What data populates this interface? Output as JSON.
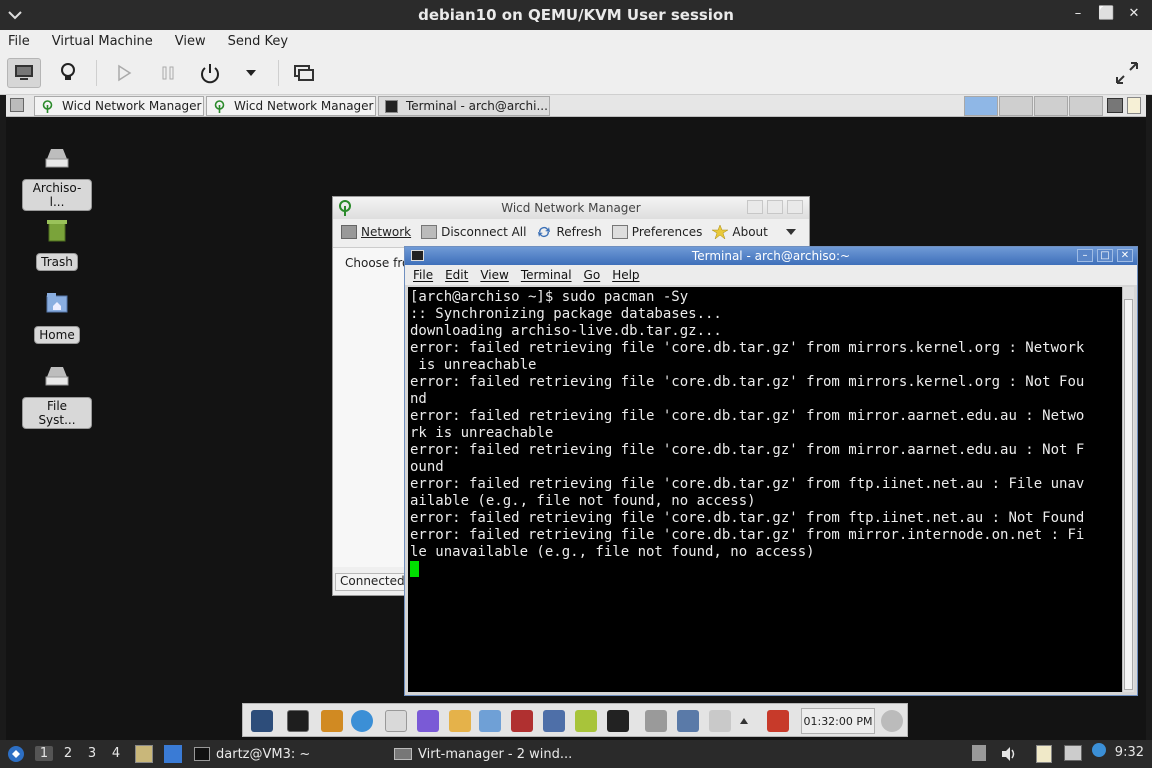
{
  "host": {
    "title": "debian10 on QEMU/KVM User session",
    "menu": [
      "File",
      "Virtual Machine",
      "View",
      "Send Key"
    ],
    "controls": {
      "minimize": "–",
      "restore": "⬜",
      "close": "✕"
    }
  },
  "guest_taskbar": {
    "tasks": [
      "Wicd Network Manager",
      "Wicd Network Manager",
      "Terminal - arch@archi..."
    ]
  },
  "desktop_icons": [
    "Archiso-l...",
    "Trash",
    "Home",
    "File Syst..."
  ],
  "wicd": {
    "title": "Wicd Network Manager",
    "toolbar": [
      "Network",
      "Disconnect All",
      "Refresh",
      "Preferences",
      "About"
    ],
    "choose_text": "Choose fro",
    "status": "Connected t"
  },
  "terminal": {
    "title": "Terminal - arch@archiso:~",
    "menu": [
      "File",
      "Edit",
      "View",
      "Terminal",
      "Go",
      "Help"
    ],
    "lines": [
      "[arch@archiso ~]$ sudo pacman -Sy",
      ":: Synchronizing package databases...",
      "downloading archiso-live.db.tar.gz...",
      "error: failed retrieving file 'core.db.tar.gz' from mirrors.kernel.org : Network",
      " is unreachable",
      "error: failed retrieving file 'core.db.tar.gz' from mirrors.kernel.org : Not Fou",
      "nd",
      "error: failed retrieving file 'core.db.tar.gz' from mirror.aarnet.edu.au : Netwo",
      "rk is unreachable",
      "error: failed retrieving file 'core.db.tar.gz' from mirror.aarnet.edu.au : Not F",
      "ound",
      "error: failed retrieving file 'core.db.tar.gz' from ftp.iinet.net.au : File unav",
      "ailable (e.g., file not found, no access)",
      "error: failed retrieving file 'core.db.tar.gz' from ftp.iinet.net.au : Not Found",
      "error: failed retrieving file 'core.db.tar.gz' from mirror.internode.on.net : Fi",
      "le unavailable (e.g., file not found, no access)"
    ]
  },
  "guest_clock": "01:32:00 PM",
  "host_panel": {
    "workspaces": [
      "1",
      "2",
      "3",
      "4"
    ],
    "active_workspace": "1",
    "tasks": [
      "dartz@VM3: ~",
      "Virt-manager - 2 wind..."
    ],
    "time": "9:32"
  }
}
